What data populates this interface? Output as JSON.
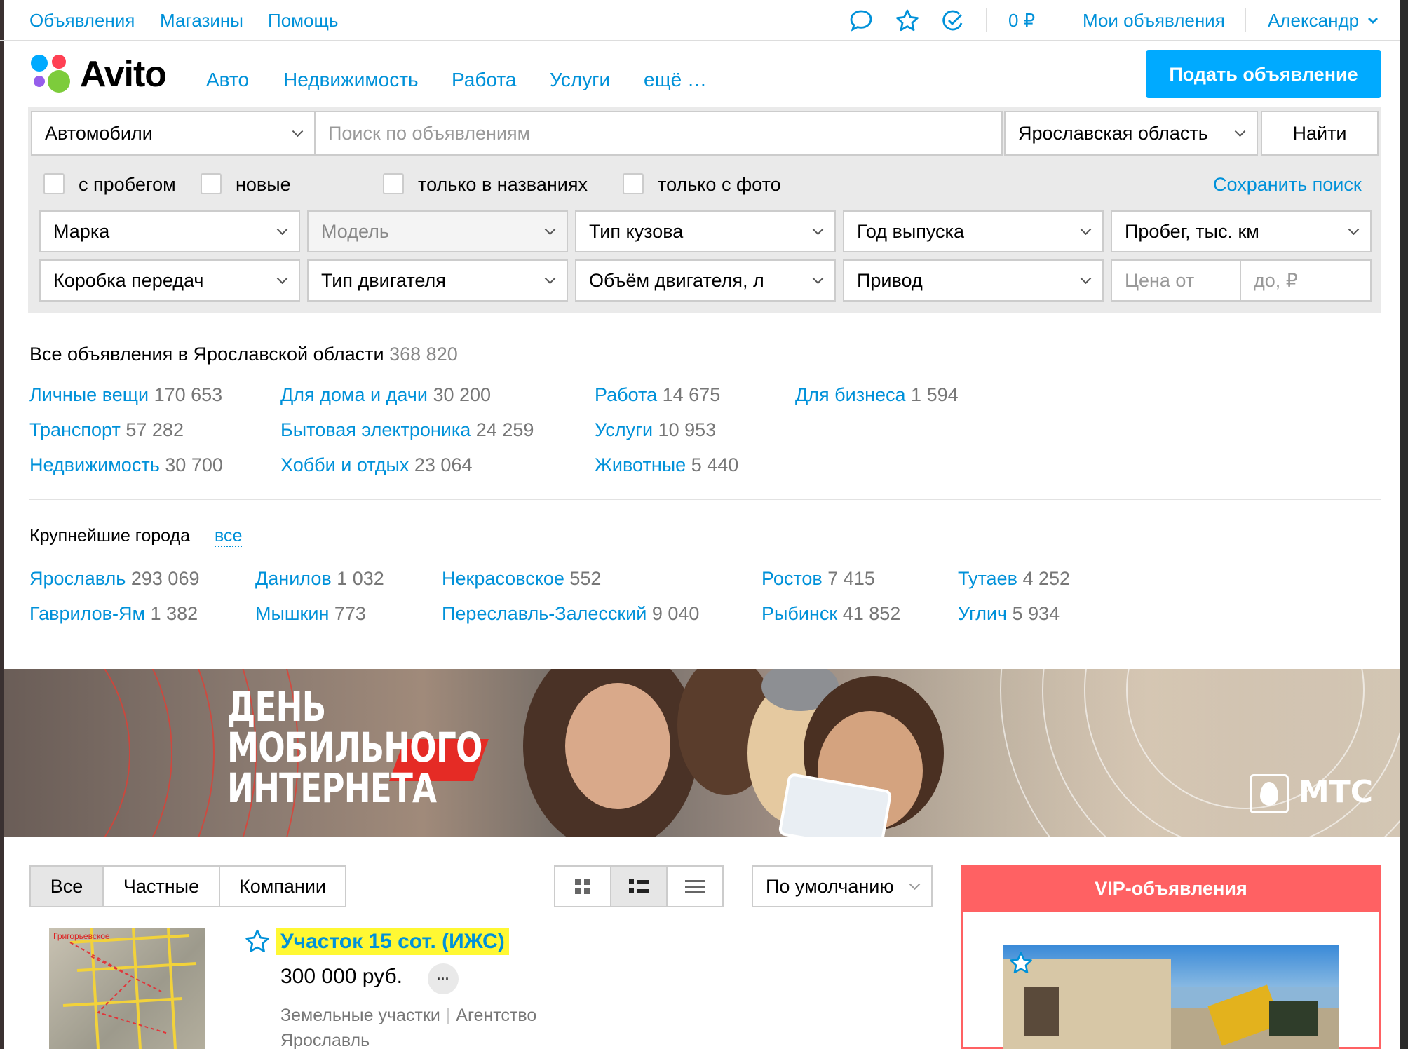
{
  "topbar": {
    "links": [
      "Объявления",
      "Магазины",
      "Помощь"
    ],
    "balance": "0 ₽",
    "my_ads": "Мои объявления",
    "user": "Александр"
  },
  "header": {
    "logo": "Avito",
    "categories": [
      "Авто",
      "Недвижимость",
      "Работа",
      "Услуги",
      "ещё …"
    ],
    "post_button": "Подать объявление"
  },
  "search": {
    "category": "Автомобили",
    "query_placeholder": "Поиск по объявлениям",
    "region": "Ярославская область",
    "find_button": "Найти",
    "checkboxes": [
      "с пробегом",
      "новые",
      "только в названиях",
      "только с фото"
    ],
    "save_search": "Сохранить поиск",
    "filters_row1": [
      "Марка",
      "Модель",
      "Тип кузова",
      "Год выпуска",
      "Пробег, тыс. км"
    ],
    "filters_row2": [
      "Коробка передач",
      "Тип двигателя",
      "Объём двигателя, л",
      "Привод"
    ],
    "price_from_placeholder": "Цена от",
    "price_to_placeholder": "до, ₽"
  },
  "stats": {
    "all_label": "Все объявления в Ярославской области",
    "all_count": "368 820",
    "categories": [
      {
        "name": "Личные вещи",
        "count": "170 653"
      },
      {
        "name": "Транспорт",
        "count": "57 282"
      },
      {
        "name": "Недвижимость",
        "count": "30 700"
      },
      {
        "name": "Для дома и дачи",
        "count": "30 200"
      },
      {
        "name": "Бытовая электроника",
        "count": "24 259"
      },
      {
        "name": "Хобби и отдых",
        "count": "23 064"
      },
      {
        "name": "Работа",
        "count": "14 675"
      },
      {
        "name": "Услуги",
        "count": "10 953"
      },
      {
        "name": "Животные",
        "count": "5 440"
      },
      {
        "name": "Для бизнеса",
        "count": "1 594"
      }
    ]
  },
  "cities": {
    "title": "Крупнейшие города",
    "all_link": "все",
    "items": [
      {
        "name": "Ярославль",
        "count": "293 069"
      },
      {
        "name": "Гаврилов-Ям",
        "count": "1 382"
      },
      {
        "name": "Данилов",
        "count": "1 032"
      },
      {
        "name": "Мышкин",
        "count": "773"
      },
      {
        "name": "Некрасовское",
        "count": "552"
      },
      {
        "name": "Переславль-Залесский",
        "count": "9 040"
      },
      {
        "name": "Ростов",
        "count": "7 415"
      },
      {
        "name": "Рыбинск",
        "count": "41 852"
      },
      {
        "name": "Тутаев",
        "count": "4 252"
      },
      {
        "name": "Углич",
        "count": "5 934"
      }
    ]
  },
  "banner": {
    "line1": "ДЕНЬ",
    "line2": "МОБИЛЬНОГО",
    "line3": "ИНТЕРНЕТА",
    "brand": "МТС"
  },
  "listing_controls": {
    "segments": [
      "Все",
      "Частные",
      "Компании"
    ],
    "sort": "По умолчанию"
  },
  "listing": {
    "title": "Участок 15 сот. (ИЖС)",
    "price": "300 000 руб.",
    "more": "···",
    "category": "Земельные участки",
    "seller": "Агентство",
    "city": "Ярославль",
    "thumb_caption": "Григорьевское"
  },
  "vip": {
    "title": "VIP-объявления"
  },
  "colors": {
    "link": "#0091d9",
    "accent_button": "#00aaff",
    "vip": "#ff6163",
    "highlight": "#fff833"
  }
}
